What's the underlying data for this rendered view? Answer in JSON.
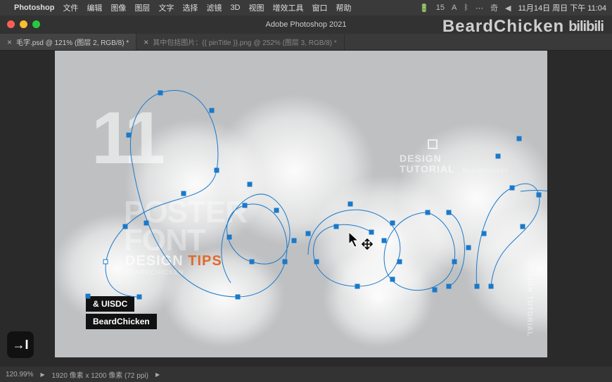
{
  "menubar": {
    "apple": "",
    "app": "Photoshop",
    "items": [
      "文件",
      "编辑",
      "图像",
      "图层",
      "文字",
      "选择",
      "滤镜",
      "3D",
      "视图",
      "增效工具",
      "窗口",
      "帮助"
    ],
    "status_icons": [
      "🔋",
      "✱",
      "A",
      "15",
      "↻",
      "⏻",
      "◧",
      "A",
      "✳︎",
      "ᛒ",
      "⋯",
      "奇",
      "☰",
      "◀",
      "⬆︎"
    ],
    "clock": "11月14日 周日 下午 11:04"
  },
  "titlebar": {
    "title": "Adobe Photoshop 2021"
  },
  "watermark": {
    "text": "BeardChicken",
    "logo": "bilibili"
  },
  "tabs": [
    {
      "label": "毛字.psd @ 121% (图层 2, RGB/8) *",
      "active": true
    },
    {
      "label": "其中包括图片：{{ pinTitle }}.png @ 252% (图层 3, RGB/8) *",
      "active": false
    }
  ],
  "canvas": {
    "big_number": "11",
    "poster_line1": "POSTER",
    "poster_line2": "FONT",
    "design": "DESIGN",
    "tips": "TIPS",
    "bc_small": "BEARDCHICKEN",
    "design_tutorial_1": "DESIGN",
    "design_tutorial_2": "TUTORIAL",
    "bc_side": "BeardChicken",
    "badge1": "& UISDC",
    "badge2": "BeardChicken",
    "vert_1": "DESIGN",
    "vert_2": "TUTORIAL"
  },
  "statusbar": {
    "zoom": "120.99%",
    "doc_info": "1920 像素 x 1200 像素 (72 ppi)",
    "arrow": "▶"
  },
  "fab": {
    "glyph": "→I"
  }
}
